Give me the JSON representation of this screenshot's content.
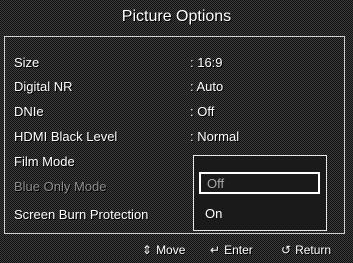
{
  "header": {
    "title": "Picture Options"
  },
  "menu": {
    "items": [
      {
        "label": "Size",
        "value": ": 16:9",
        "disabled": false
      },
      {
        "label": "Digital NR",
        "value": ": Auto",
        "disabled": false
      },
      {
        "label": "DNIe",
        "value": ": Off",
        "disabled": false
      },
      {
        "label": "HDMI Black Level",
        "value": ": Normal",
        "disabled": false
      },
      {
        "label": "Film Mode",
        "value": "",
        "disabled": false
      },
      {
        "label": "Blue Only Mode",
        "value": "",
        "disabled": true
      },
      {
        "label": "Screen Burn Protection",
        "value": "",
        "disabled": false
      }
    ]
  },
  "dropdown": {
    "options": [
      "Off",
      "On"
    ],
    "selected": "Off"
  },
  "footer": {
    "move_label": "Move",
    "move_icon": "up-down-arrows-icon",
    "enter_label": "Enter",
    "enter_icon": "enter-icon",
    "return_label": "Return",
    "return_icon": "return-icon"
  },
  "colors": {
    "text": "#ffffff",
    "disabled_text": "#8e8e8e",
    "border": "#cfcfcf"
  }
}
